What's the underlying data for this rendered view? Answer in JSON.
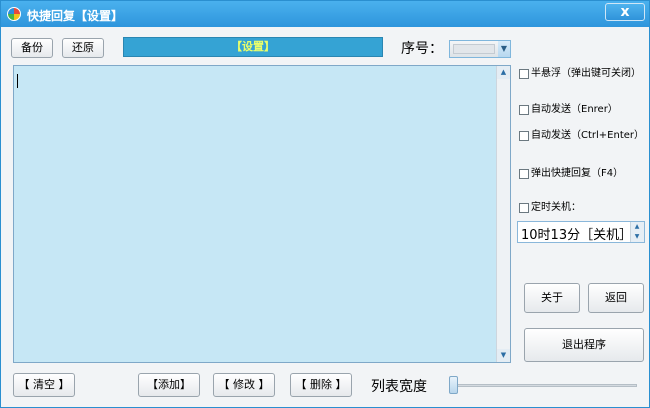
{
  "window": {
    "title": "快捷回复【设置】",
    "close_label": "x"
  },
  "toolbar": {
    "backup_label": "备份",
    "restore_label": "还原",
    "banner_text": "【设置】",
    "seq_label": "序号：",
    "seq_value": ""
  },
  "editor": {
    "content": ""
  },
  "options": {
    "translucent": "半悬浮（弹出键可关闭）",
    "auto_send_enter": "自动发送（Enrer）",
    "auto_send_ctrl_enter": "自动发送（Ctrl+Enter）",
    "popup_quick_reply": "弹出快捷回复（F4）",
    "timed_shutdown": "定时关机：",
    "shutdown_time": "10时13分［关机］"
  },
  "side_buttons": {
    "about": "关于",
    "back": "返回",
    "exit": "退出程序"
  },
  "bottom": {
    "clear": "【 清空 】",
    "add": "【添加】",
    "edit": "【 修改 】",
    "delete": "【 删除 】",
    "list_width_label": "列表宽度",
    "list_width_value": 0
  },
  "colors": {
    "titlebar": "#3aa3e6",
    "banner": "#35a3d4",
    "banner_text": "#eaff6a",
    "editor_bg": "#c6e7f5"
  }
}
